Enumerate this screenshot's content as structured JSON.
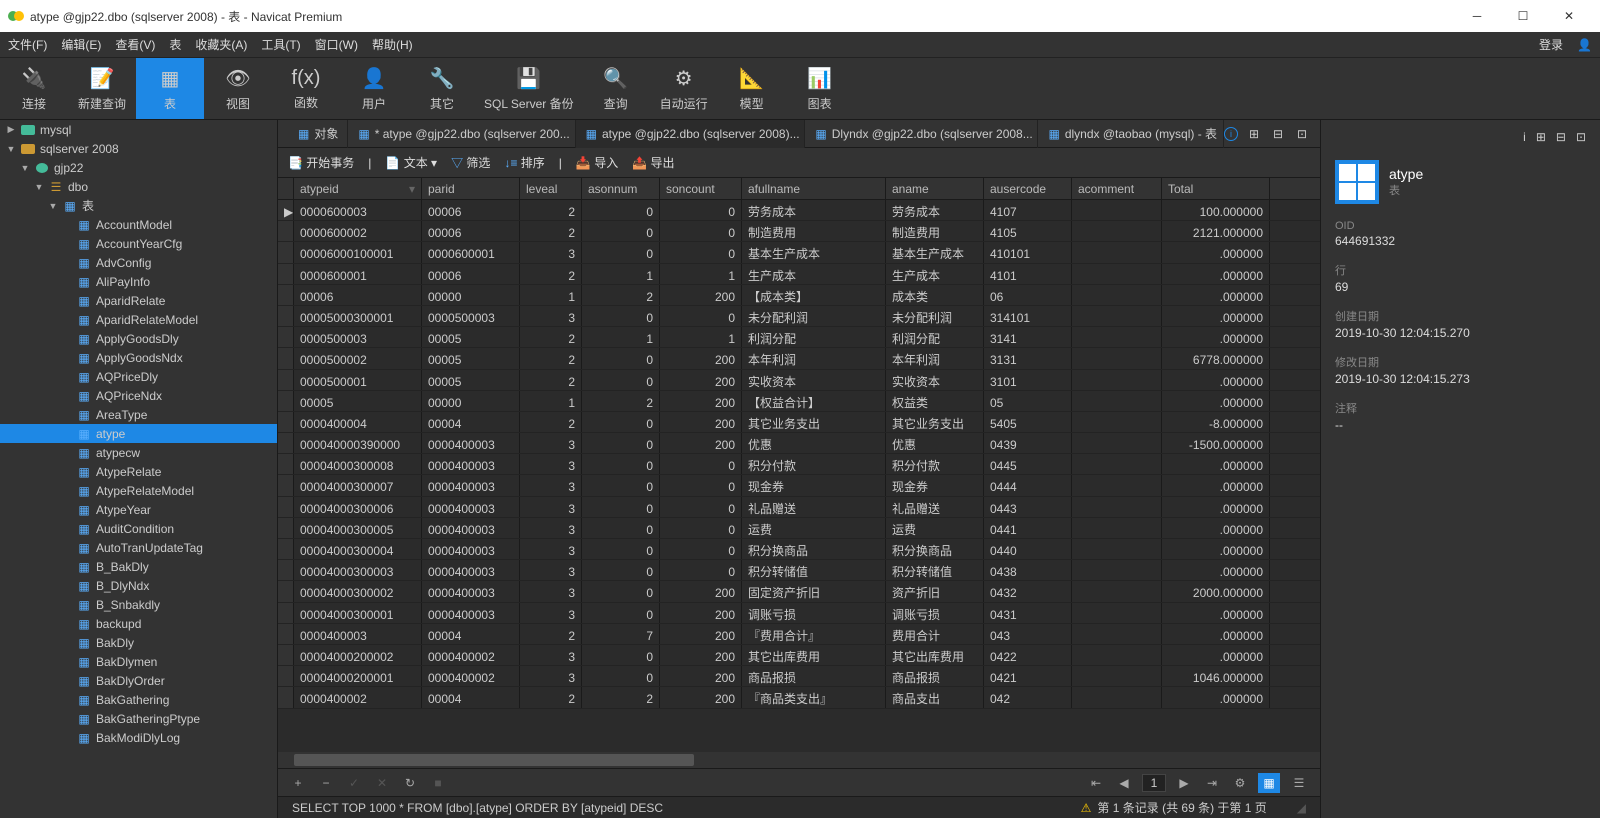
{
  "title": "atype @gjp22.dbo (sqlserver 2008) - 表 - Navicat Premium",
  "menus": [
    "文件(F)",
    "编辑(E)",
    "查看(V)",
    "表",
    "收藏夹(A)",
    "工具(T)",
    "窗口(W)",
    "帮助(H)"
  ],
  "login": "登录",
  "toolbar": [
    {
      "l": "连接"
    },
    {
      "l": "新建查询"
    },
    {
      "l": "表",
      "active": true
    },
    {
      "l": "视图"
    },
    {
      "l": "函数"
    },
    {
      "l": "用户"
    },
    {
      "l": "其它"
    },
    {
      "l": "SQL Server 备份"
    },
    {
      "l": "查询"
    },
    {
      "l": "自动运行"
    },
    {
      "l": "模型"
    },
    {
      "l": "图表"
    }
  ],
  "tree": {
    "mysql": "mysql",
    "sqlserver": "sqlserver 2008",
    "gjp22": "gjp22",
    "dbo": "dbo",
    "tables": "表",
    "items": [
      "AccountModel",
      "AccountYearCfg",
      "AdvConfig",
      "AliPayInfo",
      "AparidRelate",
      "AparidRelateModel",
      "ApplyGoodsDly",
      "ApplyGoodsNdx",
      "AQPriceDly",
      "AQPriceNdx",
      "AreaType",
      "atype",
      "atypecw",
      "AtypeRelate",
      "AtypeRelateModel",
      "AtypeYear",
      "AuditCondition",
      "AutoTranUpdateTag",
      "B_BakDly",
      "B_DlyNdx",
      "B_Snbakdly",
      "backupd",
      "BakDly",
      "BakDlymen",
      "BakDlyOrder",
      "BakGathering",
      "BakGatheringPtype",
      "BakModiDlyLog"
    ]
  },
  "tabs": [
    {
      "l": "对象"
    },
    {
      "l": "* atype @gjp22.dbo (sqlserver 200...",
      "mod": true
    },
    {
      "l": "atype @gjp22.dbo (sqlserver 2008)...",
      "active": true
    },
    {
      "l": "Dlyndx @gjp22.dbo (sqlserver 2008..."
    },
    {
      "l": "dlyndx @taobao (mysql) - 表"
    }
  ],
  "tabtool": {
    "begin": "开始事务",
    "text": "文本",
    "filter": "筛选",
    "sort": "排序",
    "import": "导入",
    "export": "导出"
  },
  "columns": [
    "atypeid",
    "parid",
    "leveal",
    "asonnum",
    "soncount",
    "afullname",
    "aname",
    "ausercode",
    "acomment",
    "Total"
  ],
  "rows": [
    [
      "0000600003",
      "00006",
      "2",
      "0",
      "0",
      "劳务成本",
      "劳务成本",
      "4107",
      "",
      "100.000000"
    ],
    [
      "0000600002",
      "00006",
      "2",
      "0",
      "0",
      "制造费用",
      "制造费用",
      "4105",
      "",
      "2121.000000"
    ],
    [
      "00006000100001",
      "0000600001",
      "3",
      "0",
      "0",
      "基本生产成本",
      "基本生产成本",
      "410101",
      "",
      ".000000"
    ],
    [
      "0000600001",
      "00006",
      "2",
      "1",
      "1",
      "生产成本",
      "生产成本",
      "4101",
      "",
      ".000000"
    ],
    [
      "00006",
      "00000",
      "1",
      "2",
      "200",
      "【成本类】",
      "成本类",
      "06",
      "",
      ".000000"
    ],
    [
      "00005000300001",
      "0000500003",
      "3",
      "0",
      "0",
      "未分配利润",
      "未分配利润",
      "314101",
      "",
      ".000000"
    ],
    [
      "0000500003",
      "00005",
      "2",
      "1",
      "1",
      "利润分配",
      "利润分配",
      "3141",
      "",
      ".000000"
    ],
    [
      "0000500002",
      "00005",
      "2",
      "0",
      "200",
      "本年利润",
      "本年利润",
      "3131",
      "",
      "6778.000000"
    ],
    [
      "0000500001",
      "00005",
      "2",
      "0",
      "200",
      "实收资本",
      "实收资本",
      "3101",
      "",
      ".000000"
    ],
    [
      "00005",
      "00000",
      "1",
      "2",
      "200",
      "【权益合计】",
      "权益类",
      "05",
      "",
      ".000000"
    ],
    [
      "0000400004",
      "00004",
      "2",
      "0",
      "200",
      "其它业务支出",
      "其它业务支出",
      "5405",
      "",
      "-8.000000"
    ],
    [
      "000040000390000",
      "0000400003",
      "3",
      "0",
      "200",
      "优惠",
      "优惠",
      "0439",
      "",
      "-1500.000000"
    ],
    [
      "00004000300008",
      "0000400003",
      "3",
      "0",
      "0",
      "积分付款",
      "积分付款",
      "0445",
      "",
      ".000000"
    ],
    [
      "00004000300007",
      "0000400003",
      "3",
      "0",
      "0",
      "现金券",
      "现金券",
      "0444",
      "",
      ".000000"
    ],
    [
      "00004000300006",
      "0000400003",
      "3",
      "0",
      "0",
      "礼品赠送",
      "礼品赠送",
      "0443",
      "",
      ".000000"
    ],
    [
      "00004000300005",
      "0000400003",
      "3",
      "0",
      "0",
      "运费",
      "运费",
      "0441",
      "",
      ".000000"
    ],
    [
      "00004000300004",
      "0000400003",
      "3",
      "0",
      "0",
      "积分换商品",
      "积分换商品",
      "0440",
      "",
      ".000000"
    ],
    [
      "00004000300003",
      "0000400003",
      "3",
      "0",
      "0",
      "积分转储值",
      "积分转储值",
      "0438",
      "",
      ".000000"
    ],
    [
      "00004000300002",
      "0000400003",
      "3",
      "0",
      "200",
      "固定资产折旧",
      "资产折旧",
      "0432",
      "",
      "2000.000000"
    ],
    [
      "00004000300001",
      "0000400003",
      "3",
      "0",
      "200",
      "调账亏损",
      "调账亏损",
      "0431",
      "",
      ".000000"
    ],
    [
      "0000400003",
      "00004",
      "2",
      "7",
      "200",
      "『费用合计』",
      "费用合计",
      "043",
      "",
      ".000000"
    ],
    [
      "00004000200002",
      "0000400002",
      "3",
      "0",
      "200",
      "其它出库费用",
      "其它出库费用",
      "0422",
      "",
      ".000000"
    ],
    [
      "00004000200001",
      "0000400002",
      "3",
      "0",
      "200",
      "商品报损",
      "商品报损",
      "0421",
      "",
      "1046.000000"
    ],
    [
      "0000400002",
      "00004",
      "2",
      "2",
      "200",
      "『商品类支出』",
      "商品支出",
      "042",
      "",
      ".000000"
    ]
  ],
  "sql": "SELECT TOP 1000 * FROM [dbo].[atype] ORDER BY [atypeid] DESC",
  "statusRight": "第 1 条记录 (共 69 条) 于第 1 页",
  "page": "1",
  "props": {
    "name": "atype",
    "type": "表",
    "fields": [
      {
        "lbl": "OID",
        "val": "644691332"
      },
      {
        "lbl": "行",
        "val": "69"
      },
      {
        "lbl": "创建日期",
        "val": "2019-10-30 12:04:15.270"
      },
      {
        "lbl": "修改日期",
        "val": "2019-10-30 12:04:15.273"
      },
      {
        "lbl": "注释",
        "val": "--"
      }
    ]
  }
}
